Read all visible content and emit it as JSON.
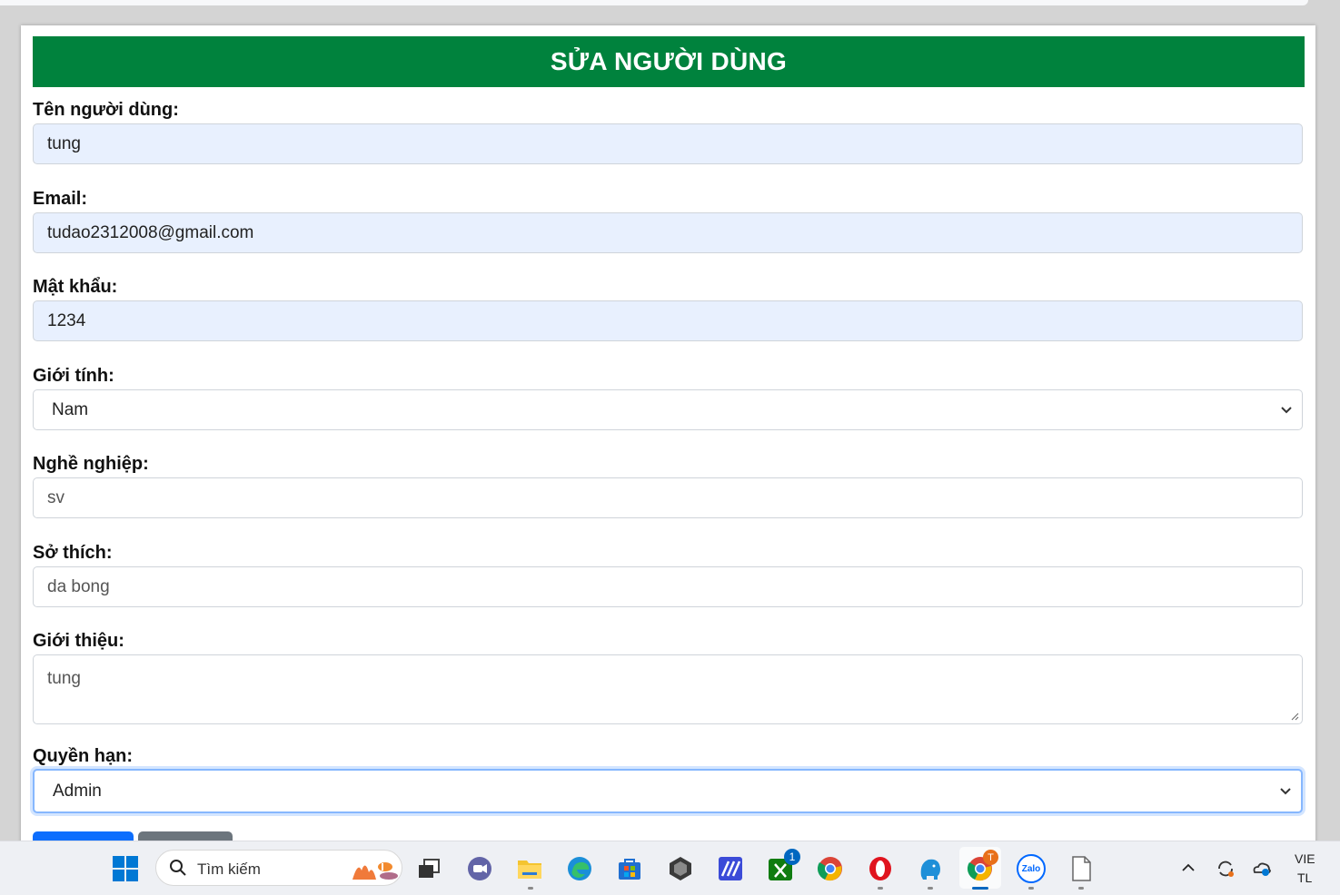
{
  "form": {
    "title": "SỬA NGƯỜI DÙNG",
    "fields": {
      "username": {
        "label": "Tên người dùng:",
        "value": "tung"
      },
      "email": {
        "label": "Email:",
        "value": "tudao2312008@gmail.com"
      },
      "password": {
        "label": "Mật khẩu:",
        "value": "1234"
      },
      "gender": {
        "label": "Giới tính:",
        "value": "Nam"
      },
      "occupation": {
        "label": "Nghề nghiệp:",
        "value": "sv"
      },
      "hobby": {
        "label": "Sở thích:",
        "value": "da bong"
      },
      "intro": {
        "label": "Giới thiệu:",
        "value": "tung"
      },
      "role": {
        "label": "Quyền hạn:",
        "value": "Admin"
      }
    },
    "colors": {
      "header": "#00823d",
      "primary_button": "#0d6efd",
      "secondary_button": "#6c757d",
      "autofill": "#e8f0fe"
    }
  },
  "taskbar": {
    "search_placeholder": "Tìm kiếm",
    "xbox_badge": "1",
    "chrome_profile_badge": "T",
    "zalo_label": "Zalo",
    "language_line1": "VIE",
    "language_line2": "TL",
    "icons": [
      "windows-start-icon",
      "search-icon",
      "task-view-icon",
      "teams-icon",
      "file-explorer-icon",
      "edge-icon",
      "store-icon",
      "app-icon",
      "stack-icon",
      "xbox-icon",
      "chrome-icon",
      "opera-icon",
      "elephant-icon",
      "chrome-profile-icon",
      "zalo-icon",
      "notepad-icon",
      "chevron-up-icon",
      "sync-icon",
      "onedrive-icon"
    ]
  }
}
